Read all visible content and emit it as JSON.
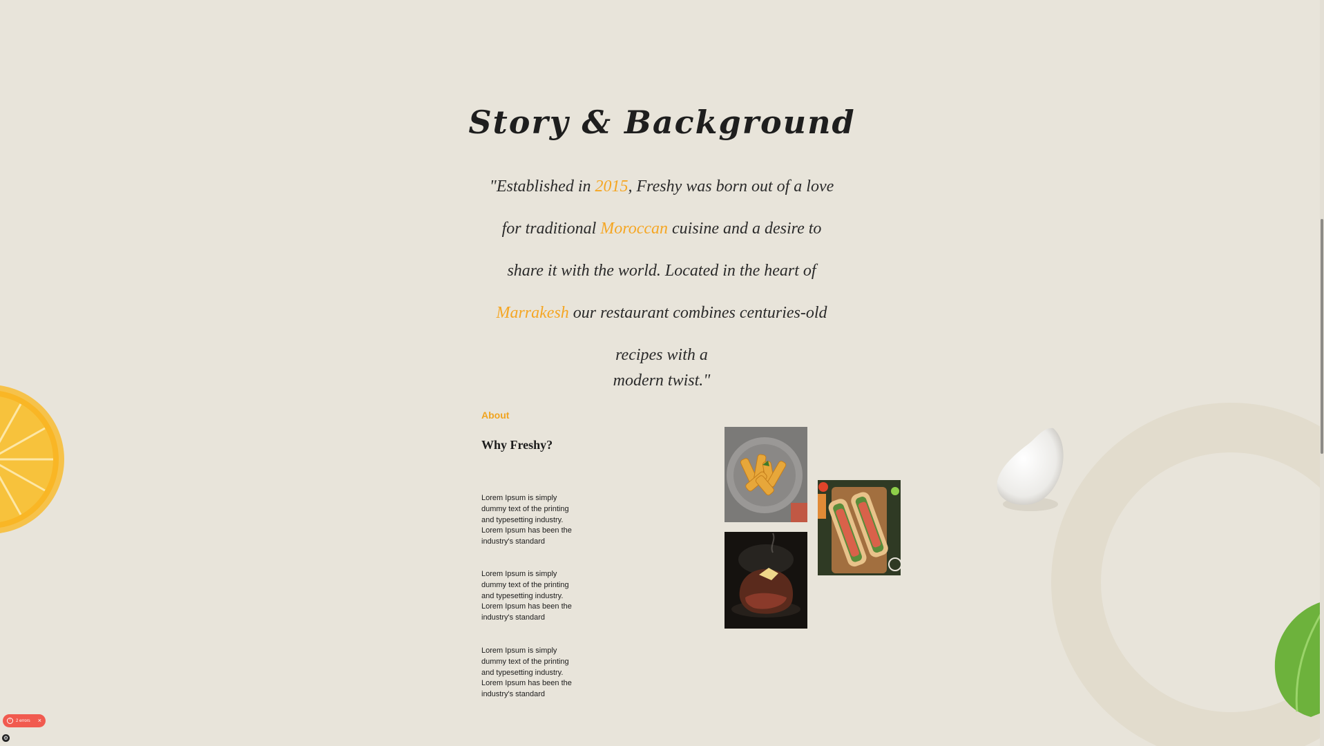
{
  "story": {
    "title": "Story & Background",
    "quote_open": "\"Established in ",
    "year": "2015",
    "part2": ", Freshy was born out of a love for traditional ",
    "cuisine": "Moroccan",
    "part3": " cuisine and a desire to share it with the world. Located in the heart of ",
    "city": "Marrakesh",
    "part4": " our restaurant combines centuries-old recipes with a",
    "tail": "modern twist.\""
  },
  "about": {
    "label": "About",
    "heading": "Why Freshy?",
    "paragraphs": [
      "Lorem Ipsum is simply dummy text of the printing and typesetting industry. Lorem Ipsum has been the industry's standard",
      "Lorem Ipsum is simply dummy text of the printing and typesetting industry. Lorem Ipsum has been the industry's standard",
      "Lorem Ipsum is simply dummy text of the printing and typesetting industry. Lorem Ipsum has been the industry's standard"
    ]
  },
  "error_badge": {
    "label": "2 errors",
    "close": "×"
  },
  "colors": {
    "background": "#e8e4da",
    "accent": "#f5a623",
    "text": "#1c1c1c",
    "error": "#f15a4f"
  },
  "icons": {
    "error": "alert-circle-icon",
    "close": "close-icon",
    "settings": "gear-icon"
  }
}
